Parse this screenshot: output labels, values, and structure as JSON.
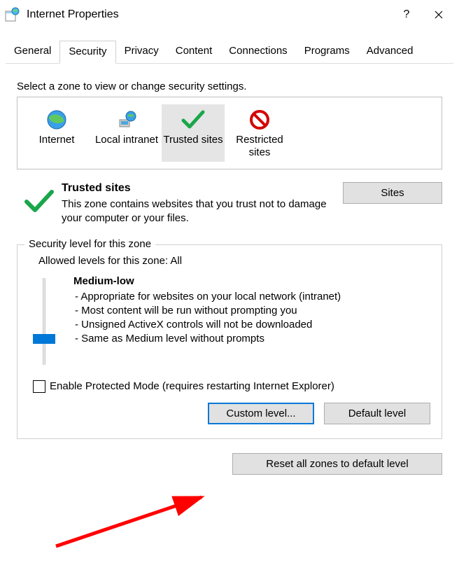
{
  "window": {
    "title": "Internet Properties"
  },
  "tabs": [
    "General",
    "Security",
    "Privacy",
    "Content",
    "Connections",
    "Programs",
    "Advanced"
  ],
  "active_tab_index": 1,
  "zone_section": {
    "label": "Select a zone to view or change security settings.",
    "zones": [
      {
        "name": "Internet"
      },
      {
        "name": "Local intranet"
      },
      {
        "name": "Trusted sites"
      },
      {
        "name": "Restricted sites"
      }
    ],
    "selected_index": 2
  },
  "description": {
    "heading": "Trusted sites",
    "body": "This zone contains websites that you trust not to damage your computer or your files.",
    "sites_button": "Sites"
  },
  "security_group": {
    "title": "Security level for this zone",
    "allowed": "Allowed levels for this zone: All",
    "level_name": "Medium-low",
    "bullets": [
      "- Appropriate for websites on your local network (intranet)",
      "- Most content will be run without prompting you",
      "- Unsigned ActiveX controls will not be downloaded",
      "- Same as Medium level without prompts"
    ],
    "protected_mode_label": "Enable Protected Mode (requires restarting Internet Explorer)",
    "custom_button": "Custom level...",
    "default_button": "Default level"
  },
  "reset_button": "Reset all zones to default level"
}
